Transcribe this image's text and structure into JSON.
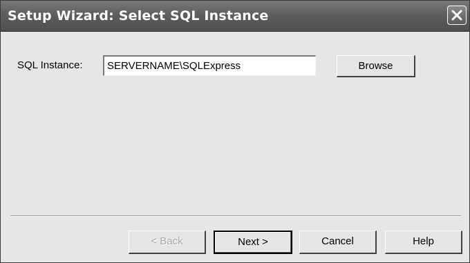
{
  "window": {
    "title": "Setup Wizard: Select SQL Instance"
  },
  "form": {
    "instance_label": "SQL Instance:",
    "instance_value": "SERVERNAME\\SQLExpress"
  },
  "buttons": {
    "browse": "Browse",
    "back": "< Back",
    "next": "Next >",
    "cancel": "Cancel",
    "help": "Help"
  },
  "state": {
    "back_enabled": false,
    "default_button": "next"
  },
  "icons": {
    "close": "close-icon"
  }
}
